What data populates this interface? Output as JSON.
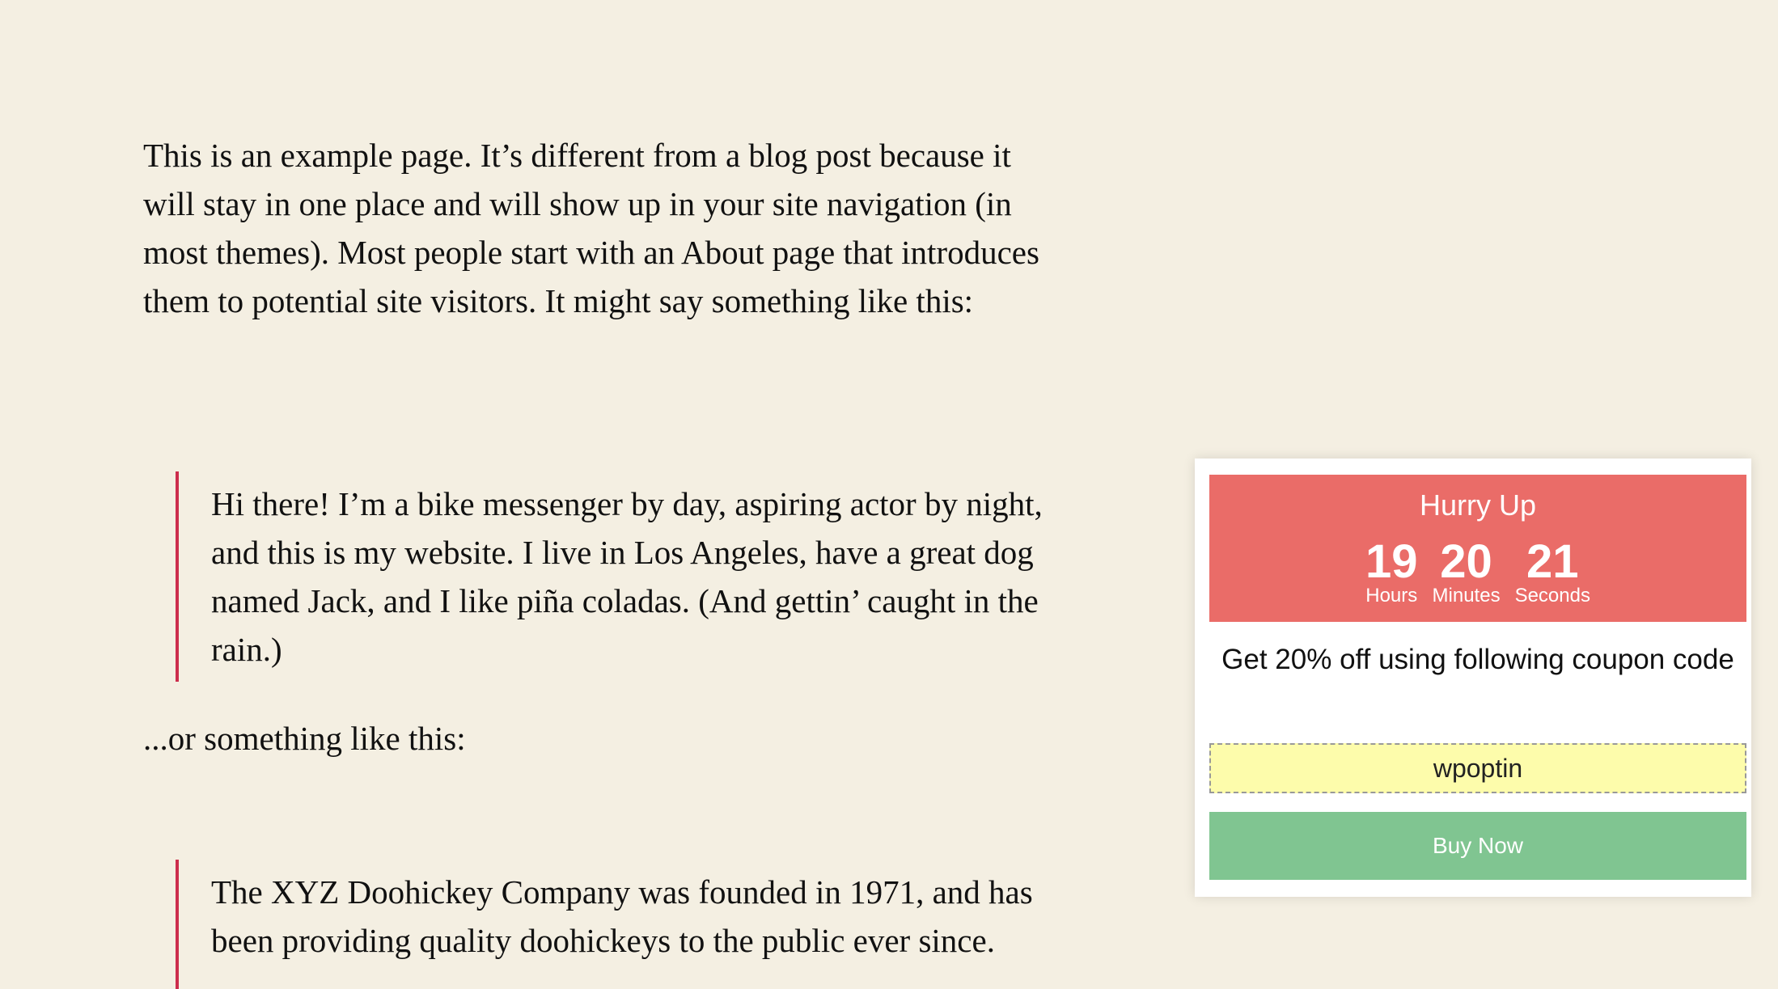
{
  "article": {
    "intro": "This is an example page. It’s different from a blog post because it will stay in one place and will show up in your site navigation (in most themes). Most people start with an About page that introduces them to potential site visitors. It might say something like this:",
    "quote1": "Hi there! I’m a bike messenger by day, aspiring actor by night, and this is my website. I live in Los Angeles, have a great dog named Jack, and I like piña coladas. (And gettin’ caught in the rain.)",
    "or_text": "...or something like this:",
    "quote2": "The XYZ Doohickey Company was founded in 1971, and has been providing quality doohickeys to the public ever since."
  },
  "promo": {
    "title": "Hurry Up",
    "countdown": [
      {
        "value": "19",
        "label": "Hours"
      },
      {
        "value": "20",
        "label": "Minutes"
      },
      {
        "value": "21",
        "label": "Seconds"
      }
    ],
    "offer_text": "Get 20% off using following coupon code",
    "coupon_code": "wpoptin",
    "button_label": "Buy Now"
  }
}
